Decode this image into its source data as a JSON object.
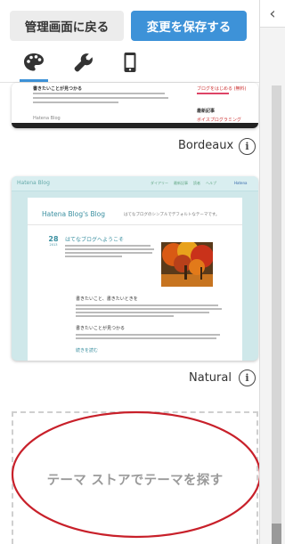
{
  "header": {
    "back_label": "管理画面に戻る",
    "save_label": "変更を保存する"
  },
  "tabs": [
    {
      "name": "design",
      "icon": "palette-icon",
      "active": true
    },
    {
      "name": "customize",
      "icon": "wrench-icon",
      "active": false
    },
    {
      "name": "smartphone",
      "icon": "smartphone-icon",
      "active": false
    }
  ],
  "themes": [
    {
      "name": "Bordeaux",
      "preview": {
        "section_heading": "書きたいことが見つかる",
        "sidebar_link_1": "ブログをはじめる (無料)",
        "sidebar_heading": "最新記事",
        "sidebar_link_2": "ボイスプログラミング",
        "tag": "Hatena Blog"
      }
    },
    {
      "name": "Natural",
      "preview": {
        "site_logo": "Hatena Blog",
        "nav_items": [
          "ダイアリー",
          "最新記事",
          "読者",
          "ヘルプ",
          "Hatena"
        ],
        "blog_title": "Hatena Blog's Blog",
        "tagline": "はてなブログのシンプルでデフォルトなテーマです。",
        "date_day": "28",
        "date_month": "2013",
        "post_title": "はてなブログへようこそ",
        "section_1": "書きたいこと、書きたいときを",
        "section_2": "書きたいことが見つかる",
        "read_more": "続きを読む"
      }
    }
  ],
  "store_link": "テーマ ストアでテーマを探す",
  "colors": {
    "accent": "#3d92d8",
    "annotation": "#c8202a",
    "natural_bg": "#cfe8ea"
  }
}
